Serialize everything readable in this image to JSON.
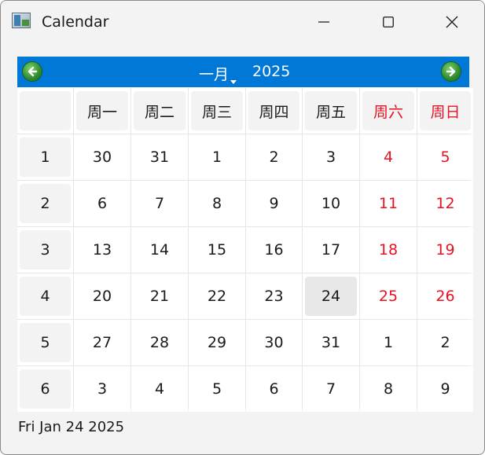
{
  "window": {
    "title": "Calendar"
  },
  "nav": {
    "month": "一月",
    "year": "2025"
  },
  "weekdays": [
    "周一",
    "周二",
    "周三",
    "周四",
    "周五",
    "周六",
    "周日"
  ],
  "weeks": [
    {
      "num": "1",
      "days": [
        "30",
        "31",
        "1",
        "2",
        "3",
        "4",
        "5"
      ]
    },
    {
      "num": "2",
      "days": [
        "6",
        "7",
        "8",
        "9",
        "10",
        "11",
        "12"
      ]
    },
    {
      "num": "3",
      "days": [
        "13",
        "14",
        "15",
        "16",
        "17",
        "18",
        "19"
      ]
    },
    {
      "num": "4",
      "days": [
        "20",
        "21",
        "22",
        "23",
        "24",
        "25",
        "26"
      ]
    },
    {
      "num": "5",
      "days": [
        "27",
        "28",
        "29",
        "30",
        "31",
        "1",
        "2"
      ]
    },
    {
      "num": "6",
      "days": [
        "3",
        "4",
        "5",
        "6",
        "7",
        "8",
        "9"
      ]
    }
  ],
  "selected": "Fri Jan 24 2025",
  "colors": {
    "accent": "#0078d7",
    "weekend": "#e81123",
    "nav_arrow": "#2e8b2e"
  },
  "icons": {
    "prev": "arrow-left-icon",
    "next": "arrow-right-icon"
  }
}
